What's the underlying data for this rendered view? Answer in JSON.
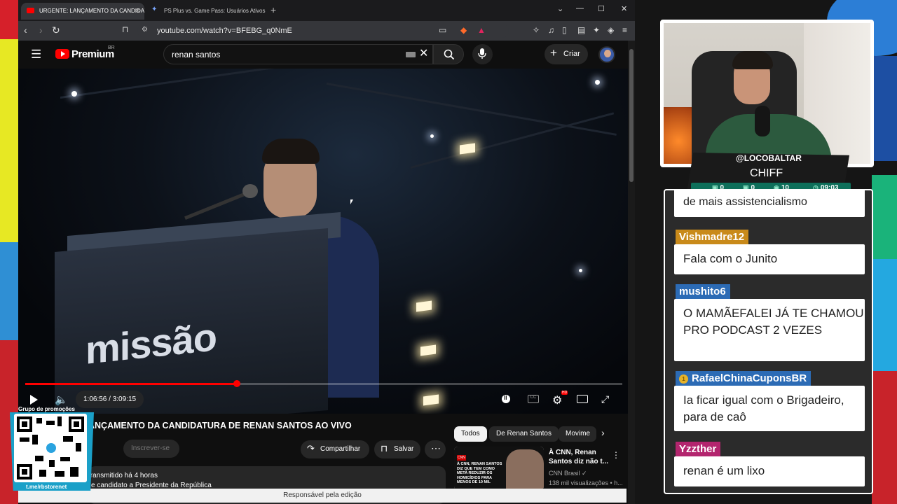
{
  "browser": {
    "tabs": [
      {
        "title": "URGENTE: LANÇAMENTO DA CANDIDATURA",
        "active": true
      },
      {
        "title": "PS Plus vs. Game Pass: Usuários Ativos - Goo",
        "active": false
      }
    ],
    "url": "youtube.com/watch?v=BFEBG_q0NmE"
  },
  "youtube": {
    "logo_text": "Premium",
    "logo_country": "BR",
    "search_value": "renan santos",
    "create_label": "Criar",
    "player": {
      "time_display": "1:06:56 / 3:09:15",
      "progress_fraction": 0.354
    },
    "video": {
      "title": "ANÇAMENTO DA CANDIDATURA DE RENAN SANTOS AO VIVO",
      "subscribe_label": "Inscrever-se",
      "share_label": "Compartilhar",
      "save_label": "Salvar",
      "desc_line1": "transmitido há 4 horas",
      "desc_line2": "e candidato a Presidente da República",
      "scene_brand": "missão"
    },
    "chips": [
      "Todos",
      "De Renan Santos",
      "Movime"
    ],
    "recommendation": {
      "title": "À CNN, Renan Santos diz não t...",
      "channel": "CNN Brasil",
      "views": "138 mil visualizações • h...",
      "thumb_badge": "CNN",
      "thumb_text": "À CNN, RENAN SANTOS DIZ QUE TEM COMO META REDUZIR OS HOMICÍDIOS PARA MENOS DE 10 MIL"
    },
    "notice": "Responsável pela edição"
  },
  "overlay": {
    "qr_label": "Grupo de promoções",
    "qr_url": "t.me/rbstorenet"
  },
  "stream": {
    "handle": "@LOCOBALTAR",
    "name": "CHIFF",
    "stats": [
      "0",
      "0",
      "10",
      "09:03"
    ],
    "chat": {
      "top_partial": "de mais assistencialismo",
      "messages": [
        {
          "user": "Vishmadre12",
          "text": "Fala com o Junito"
        },
        {
          "user": "mushito6",
          "text": "O MAMÃEFALEI JÁ TE CHAMOU PRO PODCAST 2 VEZES"
        },
        {
          "user": "RafaelChinaCuponsBR",
          "text": "Ia ficar igual com o Brigadeiro, para de caô"
        },
        {
          "user": "Yzzther",
          "text": "renan é um lixo"
        }
      ]
    }
  },
  "colors": {
    "yt_red": "#ff0000",
    "chat_gold": "#c98a1a",
    "chat_blue": "#2c6bb5",
    "chat_pink": "#b3256e",
    "stats_green": "#0e6f5a"
  }
}
